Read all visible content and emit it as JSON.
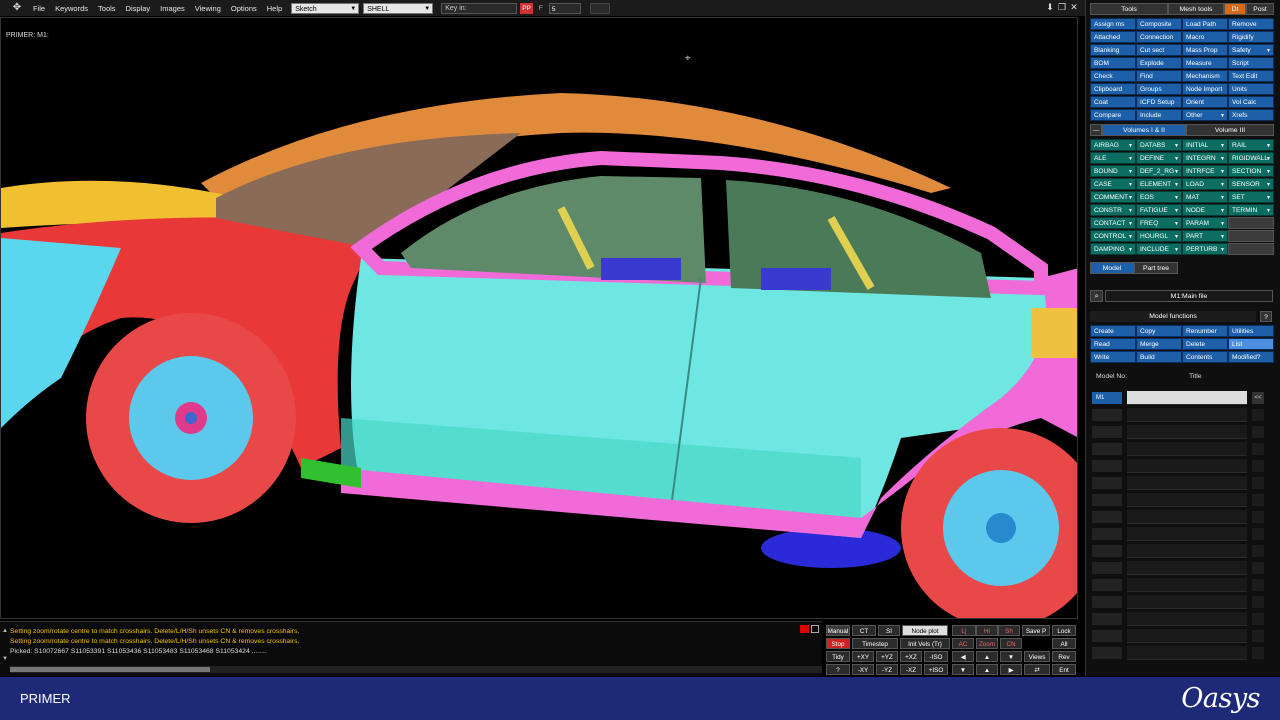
{
  "menu": {
    "items": [
      "File",
      "Keywords",
      "Tools",
      "Display",
      "Images",
      "Viewing",
      "Options",
      "Help"
    ],
    "combo1": "Sketch",
    "combo2": "SHELL",
    "keyin_placeholder": "Key in:",
    "btn_pp": "PP",
    "btn_f": "F",
    "field_value": "5"
  },
  "viewport": {
    "model_label": "PRIMER: M1:"
  },
  "messages": {
    "line1": "Setting zoom/rotate centre to match crosshairs. Delete/L/H/Sh unsets CN & removes crosshairs.",
    "line2": "Setting zoom/rotate centre to match crosshairs. Delete/L/H/Sh unsets CN & removes crosshairs.",
    "line3": "Picked: S10072667 S11053391 S11053436 S11053483 S11053468 S11053424 ........"
  },
  "viewctl": {
    "manual": "Manual",
    "ct": "CT",
    "si": "SI",
    "node_plot": "Node plot",
    "lock": "Lock",
    "stop": "Stop",
    "timestep": "Timestep",
    "init_vels": "Init Vels (Tr)",
    "ac": "AC",
    "zoom": "Zoom",
    "cn": "CN",
    "all": "All",
    "tidy": "Tidy",
    "px": "+XY",
    "pyz": "+YZ",
    "pxz": "+XZ",
    "iso": "-ISO",
    "views": "Views",
    "rev": "Rev",
    "q": "?",
    "mxy": "-XY",
    "myz": "-YZ",
    "mxz": "-XZ",
    "piso": "+ISO",
    "ent": "Ent",
    "hi": "Hi",
    "sh": "Sh",
    "save_p": "Save P"
  },
  "panel": {
    "tabs": [
      "Tools",
      "Mesh tools",
      "Post"
    ],
    "tools": [
      [
        "Assign ms",
        "Composite",
        "Load Path",
        "Remove"
      ],
      [
        "Attached",
        "Connection",
        "Macro",
        "Rigidify"
      ],
      [
        "Blanking",
        "Cut sect",
        "Mass Prop",
        "Safety"
      ],
      [
        "BOM",
        "Explode",
        "Measure",
        "Script"
      ],
      [
        "Check",
        "Find",
        "Mechanism",
        "Text Edit"
      ],
      [
        "Clipboard",
        "Groups",
        "Node Import",
        "Units"
      ],
      [
        "Coat",
        "ICFD Setup",
        "Orient",
        "Vol Calc"
      ],
      [
        "Compare",
        "Include",
        "Other",
        "Xrefs"
      ]
    ],
    "vol_tabs": [
      "Volumes I & II",
      "Volume III"
    ],
    "keywords": [
      [
        "AIRBAG",
        "DATABS",
        "INITIAL",
        "RAIL"
      ],
      [
        "ALE",
        "DEFINE",
        "INTEGRN",
        "RIGIDWALL"
      ],
      [
        "BOUND",
        "DEF_2_RG",
        "INTRFCE",
        "SECTION"
      ],
      [
        "CASE",
        "ELEMENT",
        "LOAD",
        "SENSOR"
      ],
      [
        "COMMENT",
        "EOS",
        "MAT",
        "SET"
      ],
      [
        "CONSTR",
        "FATIGUE",
        "NODE",
        "TERMIN"
      ],
      [
        "CONTACT",
        "FREQ",
        "PARAM",
        ""
      ],
      [
        "CONTROL",
        "HOURGL",
        "PART",
        ""
      ],
      [
        "DAMPING",
        "INCLUDE",
        "PERTURB",
        ""
      ]
    ],
    "model_tabs": [
      "Model",
      "Part tree"
    ],
    "main_file": "M1:Main file",
    "model_functions_title": "Model functions",
    "help": "?",
    "functions": [
      [
        "Create",
        "Copy",
        "Renumber",
        "Utilities"
      ],
      [
        "Read",
        "Merge",
        "Delete",
        "List"
      ],
      [
        "Write",
        "Build",
        "Contents",
        "Modified?"
      ]
    ],
    "model_no_label": "Model No:",
    "title_label": "Title",
    "first_model_id": "M1",
    "first_model_btn": "<<"
  },
  "statusbar": {
    "app_name": "PRIMER",
    "brand": "Oasys"
  },
  "colors": {
    "tool_button": "#1d5fa8",
    "keyword_button": "#0c6d63",
    "status_bar": "#1e2a78"
  }
}
